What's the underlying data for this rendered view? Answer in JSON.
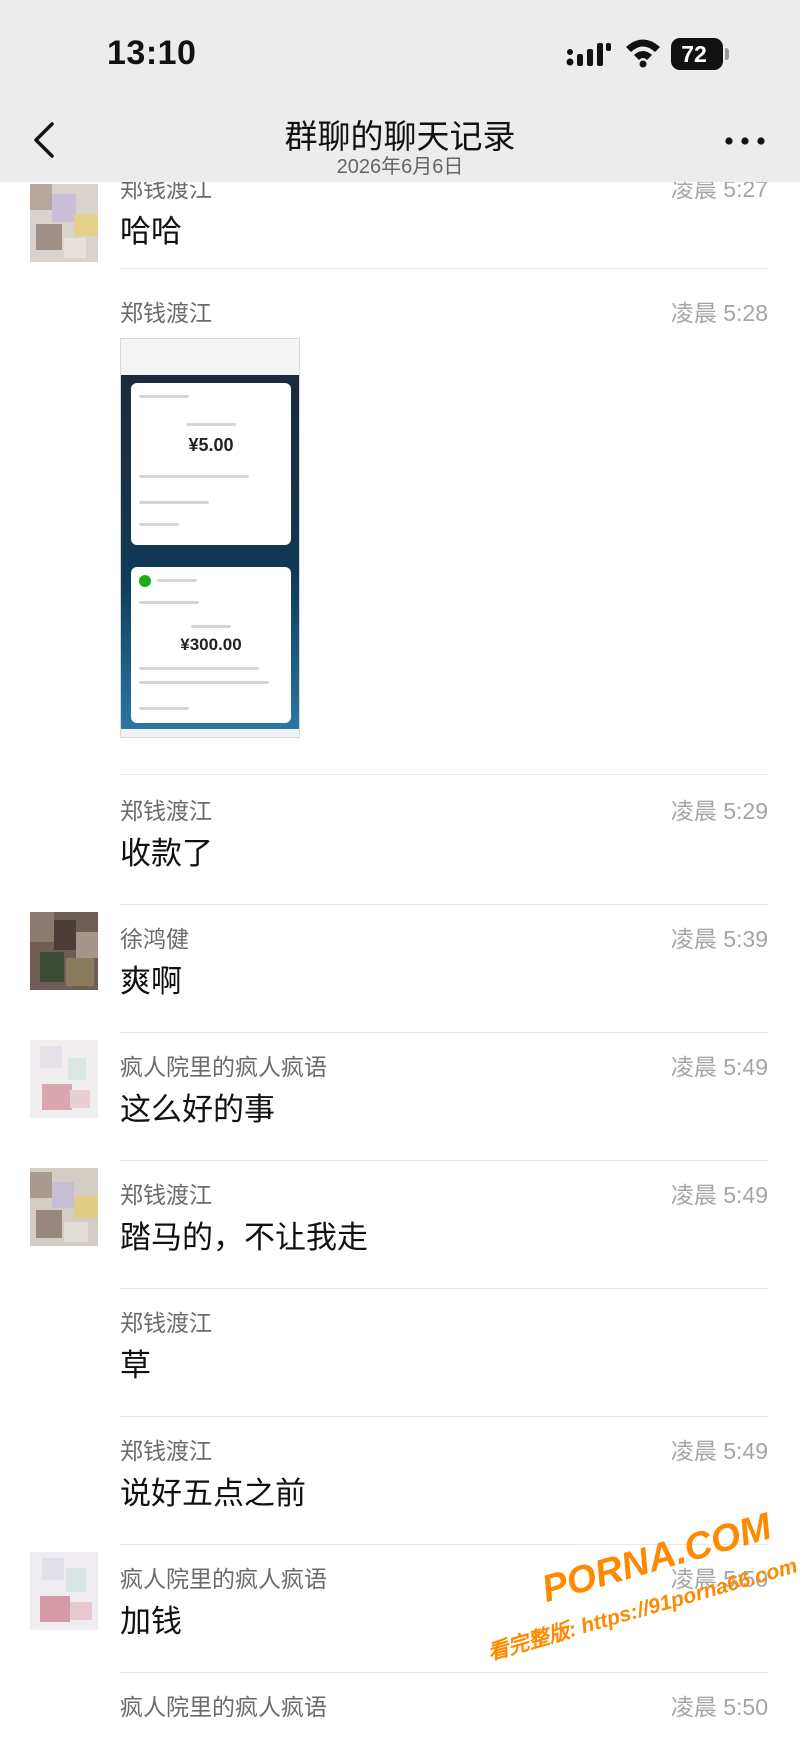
{
  "status_bar": {
    "time": "13:10",
    "battery": "72",
    "icons": [
      "signal-icon",
      "wifi-icon",
      "battery-icon"
    ]
  },
  "nav": {
    "title": "群聊的聊天记录",
    "subtitle": "2026年6月6日",
    "icons": [
      "back-icon",
      "more-icon"
    ]
  },
  "messages": [
    {
      "sender": "郑钱渡江",
      "time": "凌晨 5:27",
      "text": "哈哈",
      "avatar": "avatar-1"
    },
    {
      "sender": "郑钱渡江",
      "time": "凌晨 5:28",
      "image": {
        "amount_1": "¥5.00",
        "amount_2": "¥300.00"
      }
    },
    {
      "sender": "郑钱渡江",
      "time": "凌晨 5:29",
      "text": "收款了"
    },
    {
      "sender": "徐鸿健",
      "time": "凌晨 5:39",
      "text": "爽啊",
      "avatar": "avatar-2"
    },
    {
      "sender": "疯人院里的疯人疯语",
      "time": "凌晨 5:49",
      "text": "这么好的事",
      "avatar": "avatar-3"
    },
    {
      "sender": "郑钱渡江",
      "time": "凌晨 5:49",
      "text": "踏马的，不让我走",
      "avatar": "avatar-1"
    },
    {
      "sender": "郑钱渡江",
      "time": "",
      "text": "草"
    },
    {
      "sender": "郑钱渡江",
      "time": "凌晨 5:49",
      "text": "说好五点之前"
    },
    {
      "sender": "疯人院里的疯人疯语",
      "time": "凌晨 5:50",
      "text": "加钱",
      "avatar": "avatar-3"
    },
    {
      "sender": "疯人院里的疯人疯语",
      "time": "凌晨 5:50"
    }
  ],
  "watermark": {
    "logo": "PORNA.COM",
    "url": "看完整版: https://91porna66.com"
  },
  "colors": {
    "bar_bg": "#ececec",
    "divider": "#e8e8e8",
    "watermark": "#ff8a00"
  }
}
